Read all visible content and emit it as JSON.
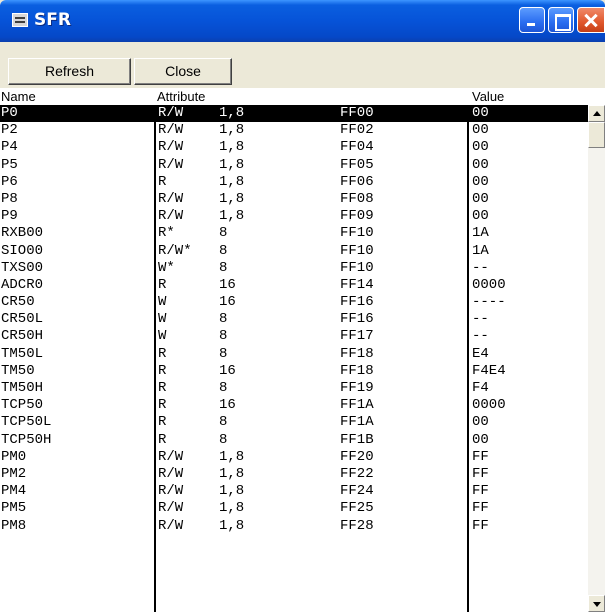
{
  "window": {
    "title": "SFR"
  },
  "toolbar": {
    "refresh_label": "Refresh",
    "close_label": "Close"
  },
  "columns": {
    "name": "Name",
    "attribute": "Attribute",
    "value": "Value"
  },
  "rows": [
    {
      "name": "P0",
      "access": "R/W",
      "size": "1,8",
      "address": "FF00",
      "value": "00",
      "selected": true
    },
    {
      "name": "P2",
      "access": "R/W",
      "size": "1,8",
      "address": "FF02",
      "value": "00"
    },
    {
      "name": "P4",
      "access": "R/W",
      "size": "1,8",
      "address": "FF04",
      "value": "00"
    },
    {
      "name": "P5",
      "access": "R/W",
      "size": "1,8",
      "address": "FF05",
      "value": "00"
    },
    {
      "name": "P6",
      "access": "R",
      "size": "1,8",
      "address": "FF06",
      "value": "00"
    },
    {
      "name": "P8",
      "access": "R/W",
      "size": "1,8",
      "address": "FF08",
      "value": "00"
    },
    {
      "name": "P9",
      "access": "R/W",
      "size": "1,8",
      "address": "FF09",
      "value": "00"
    },
    {
      "name": "RXB00",
      "access": "R*",
      "size": "8",
      "address": "FF10",
      "value": "1A"
    },
    {
      "name": "SIO00",
      "access": "R/W*",
      "size": "8",
      "address": "FF10",
      "value": "1A"
    },
    {
      "name": "TXS00",
      "access": "W*",
      "size": "8",
      "address": "FF10",
      "value": "--"
    },
    {
      "name": "ADCR0",
      "access": "R",
      "size": "16",
      "address": "FF14",
      "value": "0000"
    },
    {
      "name": "CR50",
      "access": "W",
      "size": "16",
      "address": "FF16",
      "value": "----"
    },
    {
      "name": "CR50L",
      "access": "W",
      "size": "8",
      "address": "FF16",
      "value": "--"
    },
    {
      "name": "CR50H",
      "access": "W",
      "size": "8",
      "address": "FF17",
      "value": "--"
    },
    {
      "name": "TM50L",
      "access": "R",
      "size": "8",
      "address": "FF18",
      "value": "E4"
    },
    {
      "name": "TM50",
      "access": "R",
      "size": "16",
      "address": "FF18",
      "value": "F4E4"
    },
    {
      "name": "TM50H",
      "access": "R",
      "size": "8",
      "address": "FF19",
      "value": "F4"
    },
    {
      "name": "TCP50",
      "access": "R",
      "size": "16",
      "address": "FF1A",
      "value": "0000"
    },
    {
      "name": "TCP50L",
      "access": "R",
      "size": "8",
      "address": "FF1A",
      "value": "00"
    },
    {
      "name": "TCP50H",
      "access": "R",
      "size": "8",
      "address": "FF1B",
      "value": "00"
    },
    {
      "name": "PM0",
      "access": "R/W",
      "size": "1,8",
      "address": "FF20",
      "value": "FF"
    },
    {
      "name": "PM2",
      "access": "R/W",
      "size": "1,8",
      "address": "FF22",
      "value": "FF"
    },
    {
      "name": "PM4",
      "access": "R/W",
      "size": "1,8",
      "address": "FF24",
      "value": "FF"
    },
    {
      "name": "PM5",
      "access": "R/W",
      "size": "1,8",
      "address": "FF25",
      "value": "FF"
    },
    {
      "name": "PM8",
      "access": "R/W",
      "size": "1,8",
      "address": "FF28",
      "value": "FF"
    }
  ]
}
